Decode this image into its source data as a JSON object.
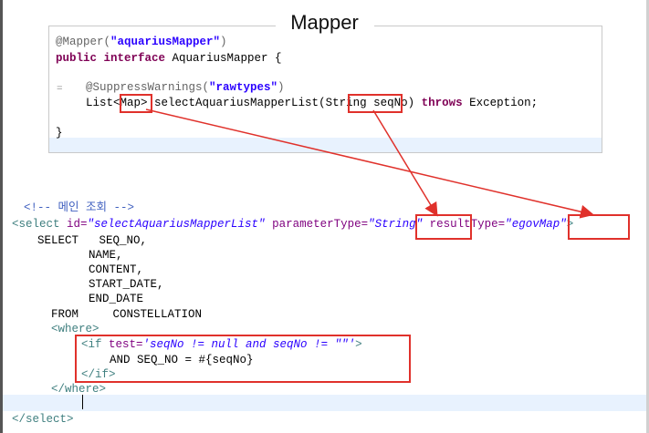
{
  "title": "Mapper",
  "java": {
    "line1_anno": "@Mapper(",
    "line1_str": "\"aquariusMapper\"",
    "line1_end": ")",
    "line2_kw": "public interface",
    "line2_rest": " AquariusMapper {",
    "line3_anno": "@SuppressWarnings(",
    "line3_str": "\"rawtypes\"",
    "line3_end": ")",
    "line4_a": "List<",
    "line4_map": "Map",
    "line4_b": "> selectAquariusMapperList(",
    "line4_string": "String",
    "line4_c": " seqNo) ",
    "line4_throws": "throws",
    "line4_d": " Exception;",
    "line5": "}",
    "gutter_mark": "="
  },
  "xml": {
    "comment": "<!-- 메인 조회 -->",
    "select_open": "<select ",
    "id_attr": "id=",
    "id_val": "\"selectAquariusMapperList\"",
    "ptype_attr": " parameterType=",
    "ptype_q1": "\"",
    "ptype_val": "String",
    "ptype_q2": "\"",
    "rtype_attr": " resultType=",
    "rtype_q1": "\"",
    "rtype_val": "egovMap",
    "rtype_q2": "\"",
    "select_close_bracket": ">",
    "l_select": "SELECT   SEQ_NO,",
    "l_name": "NAME,",
    "l_content": "CONTENT,",
    "l_start": "START_DATE,",
    "l_end": "END_DATE",
    "l_from": "FROM     CONSTELLATION",
    "where_open": "<where>",
    "if_open": "<if ",
    "if_attr": "test=",
    "if_val": "'seqNo != null and seqNo != \"\"'",
    "if_close": ">",
    "and_line": "AND SEQ_NO = #{seqNo}",
    "if_end": "</if>",
    "where_end": "</where>",
    "select_end": "</select>"
  }
}
